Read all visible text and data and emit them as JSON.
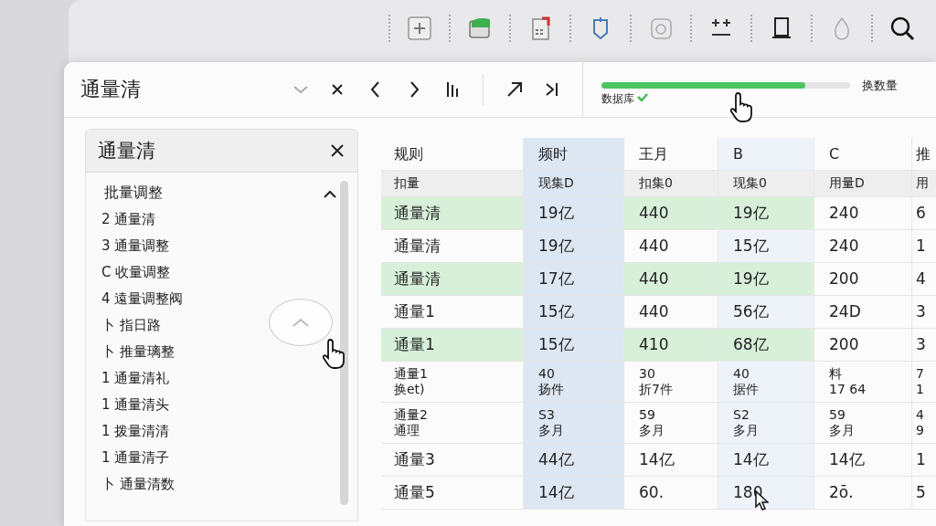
{
  "header": {
    "title": "通量清",
    "progress": {
      "level": 0.82,
      "caption": "数据库",
      "verified": true,
      "label": "换数量"
    }
  },
  "sidebar": {
    "title": "通量清",
    "group": {
      "label": "批量调整",
      "expanded": true,
      "items": [
        "2 通量清",
        "3 通量调整",
        "C 收量调整",
        "4 遠量调整阀",
        "卜 指日路",
        "卜 推量璃整",
        "1 通量清礼",
        "1 通量清头",
        "1 拨量清清",
        "1 通量清子",
        "卜 通量清数"
      ]
    }
  },
  "table": {
    "columns": [
      {
        "label": "规则",
        "sublabel": "扣量",
        "selected": false,
        "highlighted": false
      },
      {
        "label": "频时",
        "sublabel": "现集D",
        "selected": true,
        "highlighted": false
      },
      {
        "label": "王月",
        "sublabel": "扣集0",
        "selected": false,
        "highlighted": false
      },
      {
        "label": "B",
        "sublabel": "现集0",
        "selected": false,
        "highlighted": true
      },
      {
        "label": "C",
        "sublabel": "用量D",
        "selected": false,
        "highlighted": false
      },
      {
        "label": "推",
        "sublabel": "用",
        "selected": false,
        "highlighted": false
      }
    ],
    "rows": [
      {
        "cells": [
          "通量清",
          "19亿",
          "440",
          "19亿",
          "240",
          "6"
        ],
        "highlighted": true
      },
      {
        "cells": [
          "通量清",
          "19亿",
          "440",
          "15亿",
          "240",
          "1"
        ],
        "highlighted": false
      },
      {
        "cells": [
          "通量清",
          "17亿",
          "440",
          "19亿",
          "200",
          "4"
        ],
        "highlighted": true
      },
      {
        "cells": [
          "通量1",
          "15亿",
          "440",
          "56亿",
          "24D",
          "3"
        ],
        "highlighted": false
      },
      {
        "cells": [
          "通量1",
          "15亿",
          "410",
          "68亿",
          "200",
          "3"
        ],
        "highlighted": true
      },
      {
        "cells": [
          "通量1\n换et)",
          "40\n扬件",
          "30\n折7件",
          "40\n据件",
          "料\n17 64",
          "7\n1"
        ],
        "highlighted": false
      },
      {
        "cells": [
          "通量2\n通理",
          "S3\n多月",
          "59\n多月",
          "S2\n多月",
          "59\n多月",
          "4\n9"
        ],
        "highlighted": false
      },
      {
        "cells": [
          "通量3",
          "44亿",
          "14亿",
          "14亿",
          "14亿",
          "1"
        ],
        "highlighted": false
      },
      {
        "cells": [
          "通量5",
          "14亿",
          "60.",
          "180",
          "2ō.",
          "5"
        ],
        "highlighted": false
      }
    ]
  }
}
